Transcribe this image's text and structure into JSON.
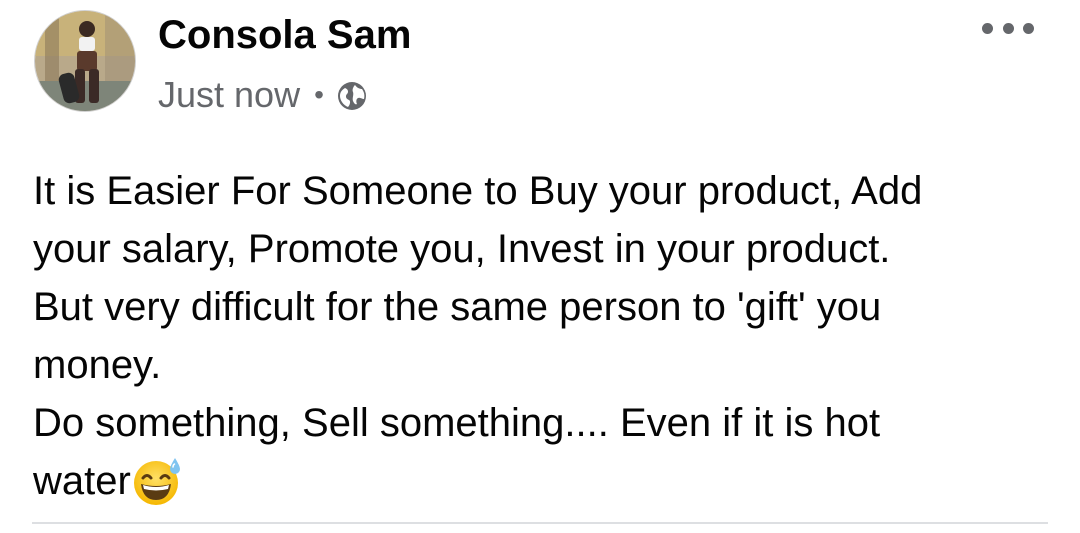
{
  "post": {
    "author": {
      "name": "Consola Sam",
      "avatar_icon": "profile-photo"
    },
    "meta": {
      "timestamp": "Just now",
      "separator": "•",
      "privacy_icon": "globe-icon"
    },
    "more_icon": "more-horizontal-icon",
    "body": {
      "lines": [
        "It is Easier For Someone to Buy your product,  Add",
        "your salary, Promote you, Invest in your product.",
        "But very difficult for the same person to 'gift' you",
        "money.",
        "Do something, Sell something.... Even if it is hot",
        "water"
      ],
      "emoji": "grinning-face-with-sweat-emoji"
    }
  },
  "colors": {
    "text": "#050505",
    "secondary_text": "#65676b",
    "divider": "#dddfe2",
    "background": "#ffffff"
  }
}
